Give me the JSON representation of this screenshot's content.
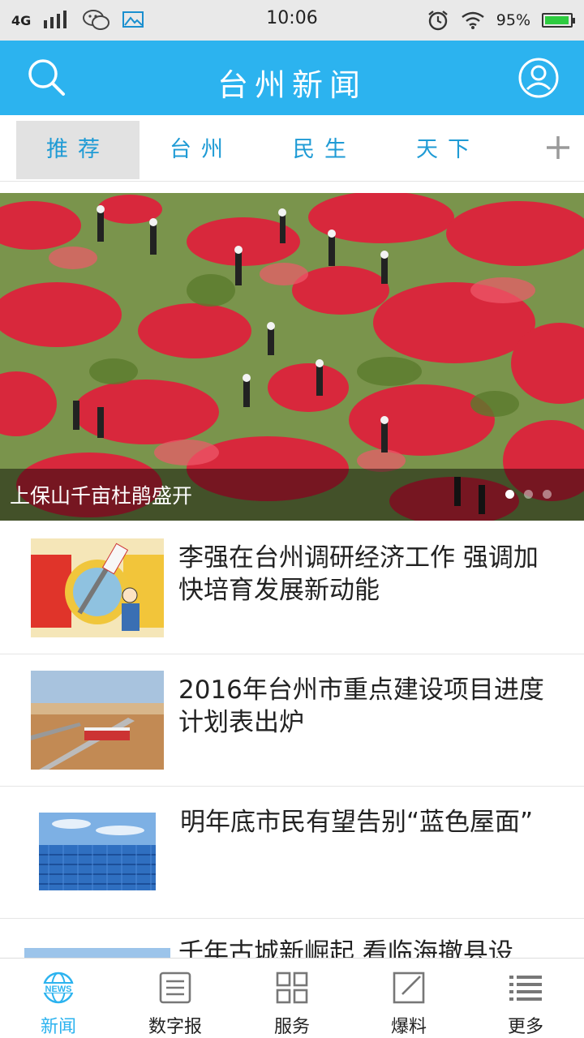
{
  "status_bar": {
    "network": "4G",
    "time": "10:06",
    "battery_percent": "95%",
    "battery_level": 0.95,
    "icons": [
      "signal-icon",
      "wechat-icon",
      "gallery-icon",
      "alarm-icon",
      "wifi-icon",
      "battery-icon"
    ]
  },
  "header": {
    "title": "台州新闻",
    "left_icon": "search-icon",
    "right_icon": "user-icon"
  },
  "tabs": [
    {
      "label": "推荐",
      "active": true
    },
    {
      "label": "台州",
      "active": false
    },
    {
      "label": "民生",
      "active": false
    },
    {
      "label": "天下",
      "active": false
    }
  ],
  "tabs_add_icon": "plus-icon",
  "banner": {
    "caption": "上保山千亩杜鹃盛开",
    "slide_count": 3,
    "active_slide": 1
  },
  "news": [
    {
      "headline": "李强在台州调研经济工作 强调加快培育发展新动能",
      "thumb": "innovation-cartoon"
    },
    {
      "headline": "2016年台州市重点建设项目进度计划表出炉",
      "thumb": "bridge-over-water"
    },
    {
      "headline": "明年底市民有望告别“蓝色屋面”",
      "thumb": "blue-roof"
    },
    {
      "headline": "千年古城新崛起 看临海撤县设",
      "thumb": "city-sky"
    }
  ],
  "bottom_nav": [
    {
      "label": "新闻",
      "icon": "news-globe-icon",
      "icon_text": "NEWS",
      "active": true
    },
    {
      "label": "数字报",
      "icon": "newspaper-icon",
      "active": false
    },
    {
      "label": "服务",
      "icon": "grid-icon",
      "active": false
    },
    {
      "label": "爆料",
      "icon": "edit-icon",
      "active": false
    },
    {
      "label": "更多",
      "icon": "list-icon",
      "active": false
    }
  ],
  "colors": {
    "brand": "#2cb3ef",
    "tab_text": "#1f9bd5",
    "active_tab_bg": "#e2e2e2",
    "status_bar_bg": "#e9e9e9"
  }
}
